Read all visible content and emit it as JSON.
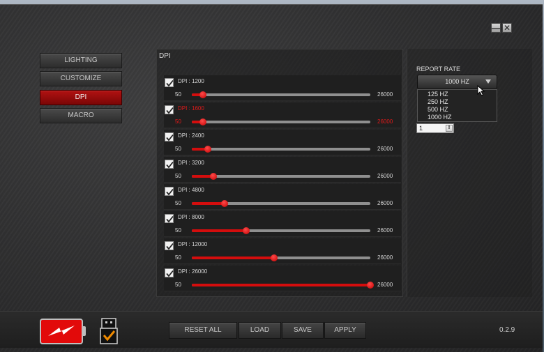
{
  "window": {
    "minimize_symbol": "—",
    "close_symbol": "✕"
  },
  "nav": {
    "items": [
      {
        "label": "LIGHTING",
        "active": false
      },
      {
        "label": "CUSTOMIZE",
        "active": false
      },
      {
        "label": "DPI",
        "active": true
      },
      {
        "label": "MACRO",
        "active": false
      }
    ]
  },
  "dpi_panel": {
    "title": "DPI",
    "range_min": 50,
    "range_max": 26000,
    "rows": [
      {
        "label": "DPI : 1200",
        "checked": true,
        "selected": false,
        "value": 1200,
        "min_label": "50",
        "max_label": "26000"
      },
      {
        "label": "DPI : 1600",
        "checked": true,
        "selected": true,
        "value": 1600,
        "min_label": "50",
        "max_label": "26000"
      },
      {
        "label": "DPI : 2400",
        "checked": true,
        "selected": false,
        "value": 2400,
        "min_label": "50",
        "max_label": "26000"
      },
      {
        "label": "DPI : 3200",
        "checked": true,
        "selected": false,
        "value": 3200,
        "min_label": "50",
        "max_label": "26000"
      },
      {
        "label": "DPI : 4800",
        "checked": true,
        "selected": false,
        "value": 4800,
        "min_label": "50",
        "max_label": "26000"
      },
      {
        "label": "DPI : 8000",
        "checked": true,
        "selected": false,
        "value": 8000,
        "min_label": "50",
        "max_label": "26000"
      },
      {
        "label": "DPI : 12000",
        "checked": true,
        "selected": false,
        "value": 12000,
        "min_label": "50",
        "max_label": "26000"
      },
      {
        "label": "DPI : 26000",
        "checked": true,
        "selected": false,
        "value": 26000,
        "min_label": "50",
        "max_label": "26000"
      }
    ]
  },
  "report_rate": {
    "label": "REPORT RATE",
    "selected": "1000 HZ",
    "options": [
      "125 HZ",
      "250 HZ",
      "500 HZ",
      "1000 HZ"
    ],
    "spin_value": "1"
  },
  "bottom": {
    "reset_label": "RESET ALL",
    "load_label": "LOAD",
    "save_label": "SAVE",
    "apply_label": "APPLY",
    "version": "0.2.9"
  },
  "colors": {
    "accent": "#d40d0d",
    "battery": "#e20a0a",
    "usb_check": "#f08a00"
  }
}
